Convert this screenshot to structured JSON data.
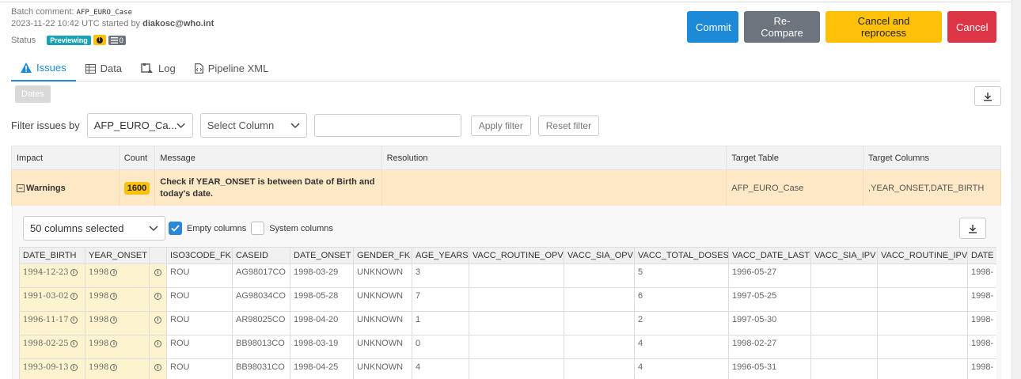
{
  "batch": {
    "comment_label": "Batch comment:",
    "comment_value": "AFP_EURO_Case",
    "started_text": "2023-11-22 10:42 UTC started by",
    "started_by": "diakosc@who.int",
    "status_label": "Status",
    "status_badge": "Previewing",
    "list_count": "0"
  },
  "actions": {
    "commit": "Commit",
    "recompare": "Re-Compare",
    "cancel_reprocess": "Cancel and reprocess",
    "cancel": "Cancel"
  },
  "tabs": [
    {
      "label": "Issues",
      "icon": "warning-triangle-icon"
    },
    {
      "label": "Data",
      "icon": "table-icon"
    },
    {
      "label": "Log",
      "icon": "log-icon"
    },
    {
      "label": "Pipeline XML",
      "icon": "file-code-icon"
    }
  ],
  "dates_button": "Dates",
  "filter": {
    "label": "Filter issues by",
    "table_value": "AFP_EURO_Ca...",
    "column_placeholder": "Select Column",
    "apply": "Apply filter",
    "reset": "Reset filter"
  },
  "issues": {
    "headers": [
      "Impact",
      "Count",
      "Message",
      "Resolution",
      "Target Table",
      "Target Columns"
    ],
    "row": {
      "impact": "Warnings",
      "count": "1600",
      "message": "Check if YEAR_ONSET is between Date of Birth and today's date.",
      "resolution": "",
      "target_table": "AFP_EURO_Case",
      "target_columns": ",YEAR_ONSET,DATE_BIRTH"
    }
  },
  "detail": {
    "columns_selected": "50 columns selected",
    "empty_columns": "Empty columns",
    "system_columns": "System columns",
    "headers": [
      "DATE_BIRTH",
      "YEAR_ONSET",
      "",
      "ISO3CODE_FK",
      "CASEID",
      "DATE_ONSET",
      "GENDER_FK",
      "AGE_YEARS",
      "VACC_ROUTINE_OPV",
      "VACC_SIA_OPV",
      "VACC_TOTAL_DOSES",
      "VACC_DATE_LAST",
      "VACC_SIA_IPV",
      "VACC_ROUTINE_IPV",
      "DATE"
    ],
    "rows": [
      [
        "1994-12-23",
        "1998",
        "",
        "ROU",
        "AG98017CO",
        "1998-03-29",
        "UNKNOWN",
        "3",
        "",
        "",
        "5",
        "1996-05-27",
        "",
        "",
        "1998-"
      ],
      [
        "1991-03-02",
        "1998",
        "",
        "ROU",
        "AG98034CO",
        "1998-05-28",
        "UNKNOWN",
        "7",
        "",
        "",
        "6",
        "1997-05-25",
        "",
        "",
        "1998-"
      ],
      [
        "1996-11-17",
        "1998",
        "",
        "ROU",
        "AR98025CO",
        "1998-04-20",
        "UNKNOWN",
        "1",
        "",
        "",
        "2",
        "1997-05-30",
        "",
        "",
        "1998-"
      ],
      [
        "1998-02-25",
        "1998",
        "",
        "ROU",
        "BB98013CO",
        "1998-03-19",
        "UNKNOWN",
        "0",
        "",
        "",
        "4",
        "1998-02-27",
        "",
        "",
        "1998-"
      ],
      [
        "1993-09-13",
        "1998",
        "",
        "ROU",
        "BB98031CO",
        "1998-04-25",
        "UNKNOWN",
        "4",
        "",
        "",
        "4",
        "1996-05-31",
        "",
        "",
        "1998-"
      ]
    ]
  },
  "colors": {
    "primary": "#1c8ad6",
    "secondary": "#6c757d",
    "warning": "#ffc107",
    "danger": "#dc3545",
    "warning_row": "#fde9c6"
  }
}
